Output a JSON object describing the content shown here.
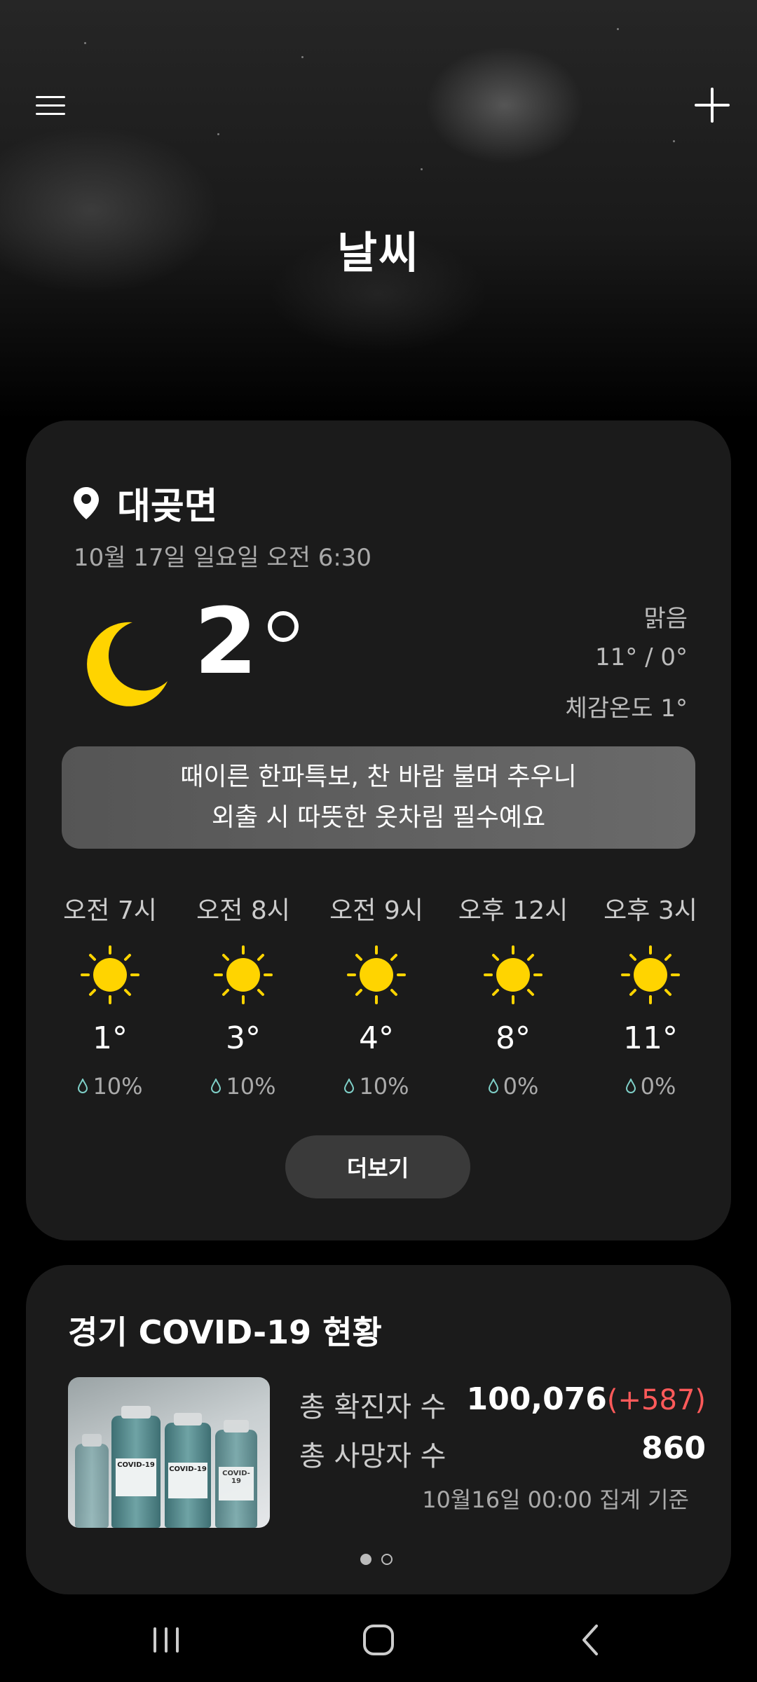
{
  "header": {
    "title": "날씨",
    "menu_icon": "hamburger-icon",
    "add_icon": "plus-icon"
  },
  "weather": {
    "location": "대곶면",
    "datetime": "10월 17일 일요일 오전 6:30",
    "current_temp": "2",
    "condition": "맑음",
    "high_low": "11° / 0°",
    "feels_like": "체감온도 1°",
    "icon": "moon-icon",
    "banner_line1": "때이른 한파특보, 찬 바람 불며 추우니",
    "banner_line2": "외출 시 따뜻한 옷차림 필수예요",
    "hourly": [
      {
        "time": "오전 7시",
        "temp": "1°",
        "rain": "10%",
        "icon": "sun-icon"
      },
      {
        "time": "오전 8시",
        "temp": "3°",
        "rain": "10%",
        "icon": "sun-icon"
      },
      {
        "time": "오전 9시",
        "temp": "4°",
        "rain": "10%",
        "icon": "sun-icon"
      },
      {
        "time": "오후 12시",
        "temp": "8°",
        "rain": "0%",
        "icon": "sun-icon"
      },
      {
        "time": "오후 3시",
        "temp": "11°",
        "rain": "0%",
        "icon": "sun-icon"
      }
    ],
    "more_label": "더보기"
  },
  "covid": {
    "title": "경기 COVID-19 현황",
    "image_alt": "COVID-19 vaccine vials",
    "vial_label": "COVID-19",
    "confirmed_label": "총 확진자 수",
    "confirmed_value": "100,076",
    "confirmed_delta": "(+587)",
    "deaths_label": "총 사망자 수",
    "deaths_value": "860",
    "basis": "10월16일 00:00 집계 기준",
    "page_index": 1,
    "page_count": 2
  },
  "colors": {
    "sun": "#FFD400",
    "moon": "#FFD400",
    "delta": "#FF5A5A",
    "card": "#1B1B1B"
  },
  "navbar": {
    "recent_icon": "recent-apps-icon",
    "home_icon": "home-icon",
    "back_icon": "back-icon"
  }
}
